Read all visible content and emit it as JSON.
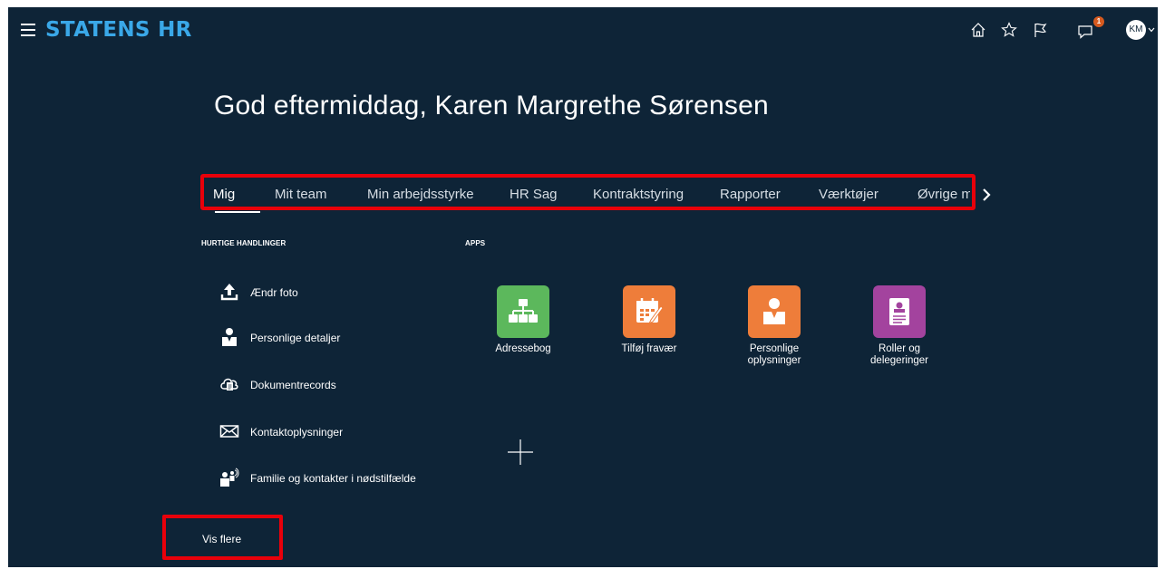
{
  "header": {
    "logo": "STATENS HR",
    "notification_count": "1",
    "avatar_initials": "KM"
  },
  "greeting": "God eftermiddag, Karen Margrethe Sørensen",
  "tabs": [
    {
      "label": "Mig",
      "active": true
    },
    {
      "label": "Mit team"
    },
    {
      "label": "Min arbejdsstyrke"
    },
    {
      "label": "HR Sag"
    },
    {
      "label": "Kontraktstyring"
    },
    {
      "label": "Rapporter"
    },
    {
      "label": "Værktøjer"
    },
    {
      "label": "Øvrige m"
    }
  ],
  "quick_actions": {
    "heading": "HURTIGE HANDLINGER",
    "items": [
      {
        "label": "Ændr foto",
        "icon": "upload-icon"
      },
      {
        "label": "Personlige detaljer",
        "icon": "person-icon"
      },
      {
        "label": "Dokumentrecords",
        "icon": "cloud-document-icon"
      },
      {
        "label": "Kontaktoplysninger",
        "icon": "envelope-icon"
      },
      {
        "label": "Familie og kontakter i nødstilfælde",
        "icon": "family-icon"
      }
    ],
    "show_more": "Vis flere"
  },
  "apps": {
    "heading": "APPS",
    "items": [
      {
        "label": "Adressebog",
        "color": "#5cb85c",
        "icon": "org-chart-icon"
      },
      {
        "label": "Tilføj fravær",
        "color": "#ee7d3a",
        "icon": "calendar-edit-icon"
      },
      {
        "label": "Personlige oplysninger",
        "color": "#ee7d3a",
        "icon": "person-card-icon"
      },
      {
        "label": "Roller og delegeringer",
        "color": "#a3439e",
        "icon": "id-badge-icon"
      }
    ]
  },
  "colors": {
    "background": "#0e2437",
    "brand": "#3aa8e8",
    "highlight": "#e8000a"
  }
}
